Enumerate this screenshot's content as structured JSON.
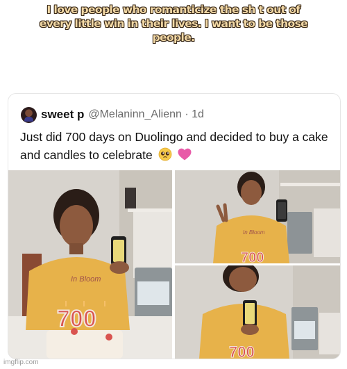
{
  "meme": {
    "caption_lines": [
      "I love people who romanticize the sh t out of",
      "every little win in their lives. I want to be those",
      "people."
    ]
  },
  "tweet": {
    "display_name": "sweet p",
    "handle_time": "@Melaninn_Alienn · 1d",
    "text": "Just did 700 days on Duolingo and decided to buy a cake and candles to celebrate",
    "emojis": [
      "pleading-face-emoji",
      "pink-heart-emoji"
    ]
  },
  "photos": {
    "candle_number": "700",
    "shirt_text": "In Bloom"
  },
  "watermark": "imgflip.com",
  "colors": {
    "caption_fill": "#f3d9a6",
    "caption_outline": "#3a2a1a",
    "shirt": "#e7b24a",
    "candle_number": "#d9534f",
    "heart": "#e85aa8"
  }
}
